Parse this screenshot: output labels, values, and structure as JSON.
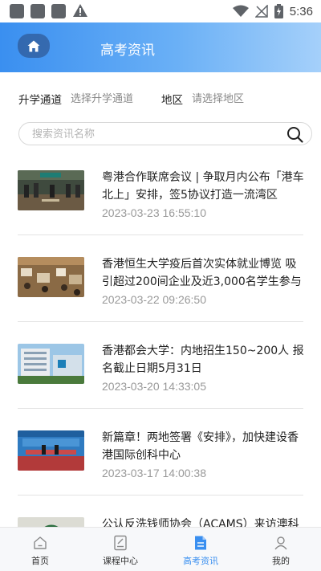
{
  "status_bar": {
    "time": "5:36"
  },
  "header": {
    "title": "高考资讯"
  },
  "filters": {
    "channel_label": "升学通道",
    "channel_placeholder": "选择升学通道",
    "region_label": "地区",
    "region_placeholder": "请选择地区"
  },
  "search": {
    "placeholder": "搜索资讯名称",
    "value": ""
  },
  "news": [
    {
      "title": "粤港合作联席会议 | 争取月内公布「港车北上」安排，签5协议打造一流湾区",
      "date": "2023-03-23 16:55:10"
    },
    {
      "title": "香港恒生大学疫后首次实体就业博览 吸引超过200间企业及近3,000名学生参与",
      "date": "2023-03-22 09:26:50"
    },
    {
      "title": "香港都会大学：内地招生150~200人 报名截止日期5月31日",
      "date": "2023-03-20 14:33:05"
    },
    {
      "title": "新篇章！两地签署《安排》，加快建设香港国际创科中心",
      "date": "2023-03-17 14:00:38"
    },
    {
      "title": "公认反洗钱师协会（ACAMS）来访澳科大",
      "date": ""
    }
  ],
  "tabbar": {
    "items": [
      {
        "label": "首页",
        "icon": "home-outline-icon"
      },
      {
        "label": "课程中心",
        "icon": "course-doc-icon"
      },
      {
        "label": "高考资讯",
        "icon": "news-doc-icon"
      },
      {
        "label": "我的",
        "icon": "user-icon"
      }
    ],
    "active_index": 2
  },
  "colors": {
    "accent": "#3a8ff0",
    "header_end": "#a5d0fa",
    "muted": "#999999"
  }
}
